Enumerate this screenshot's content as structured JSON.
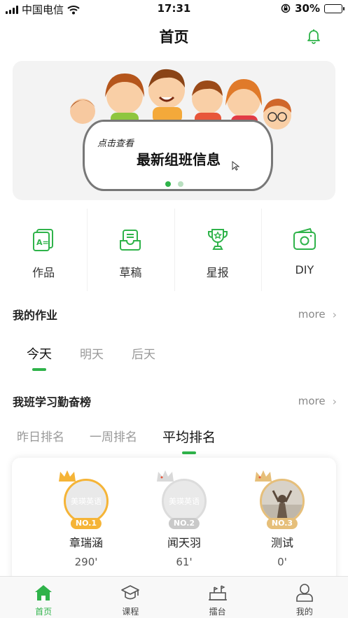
{
  "status_bar": {
    "carrier": "中国电信",
    "time": "17:31",
    "battery_percent": "30%",
    "battery_level": 0.3,
    "icons": [
      "signal-icon",
      "wifi-icon",
      "orientation-lock-icon",
      "battery-icon"
    ]
  },
  "header": {
    "title": "首页",
    "right_icon": "bell-icon"
  },
  "banner": {
    "small_text": "点击查看",
    "big_text": "最新组班信息",
    "slide_count": 2,
    "active_slide": 0
  },
  "shortcuts": [
    {
      "label": "作品",
      "icon": "works-icon"
    },
    {
      "label": "草稿",
      "icon": "draft-icon"
    },
    {
      "label": "星报",
      "icon": "trophy-icon"
    },
    {
      "label": "DIY",
      "icon": "camera-icon"
    }
  ],
  "homework": {
    "title": "我的作业",
    "more_label": "more",
    "tabs": [
      "今天",
      "明天",
      "后天"
    ],
    "active_tab": 0
  },
  "ranking": {
    "title": "我班学习勤奋榜",
    "more_label": "more",
    "tabs": [
      "昨日排名",
      "一周排名",
      "平均排名"
    ],
    "active_tab": 2,
    "entries": [
      {
        "rank": "NO.1",
        "name": "章瑞涵",
        "score": "290'",
        "avatar_text": "美瑛英语",
        "color": "#f5b437"
      },
      {
        "rank": "NO.2",
        "name": "闻天羽",
        "score": "61'",
        "avatar_text": "美瑛英语",
        "color": "#c9c9c9"
      },
      {
        "rank": "NO.3",
        "name": "测试",
        "score": "0'",
        "avatar_text": "",
        "color": "#e6bf7a"
      }
    ]
  },
  "tabbar": {
    "items": [
      {
        "label": "首页",
        "icon": "home-icon"
      },
      {
        "label": "课程",
        "icon": "graduation-cap-icon"
      },
      {
        "label": "擂台",
        "icon": "stage-icon"
      },
      {
        "label": "我的",
        "icon": "profile-icon"
      }
    ],
    "active": 0
  },
  "colors": {
    "accent": "#2fb34a",
    "gold": "#f5b437",
    "silver": "#c9c9c9",
    "bronze": "#e6bf7a"
  }
}
